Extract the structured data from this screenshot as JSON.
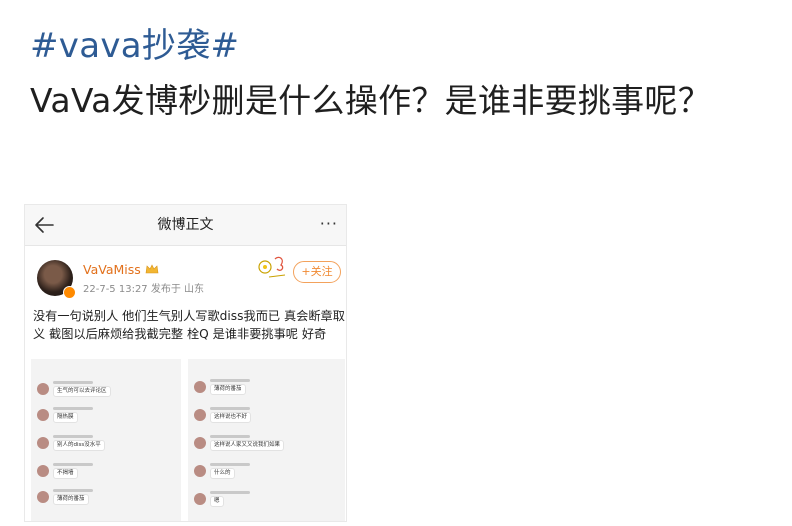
{
  "post": {
    "hashtag": "#vava抄袭#",
    "text": "VaVa发博秒删是什么操作？是谁非要挑事呢？"
  },
  "screenshot": {
    "page_title": "微博正文",
    "more_label": "···",
    "user_name": "VaVaMiss",
    "meta": "22-7-5 13:27  发布于 山东",
    "follow_label": "+关注",
    "body": "没有一句说别人 他们生气别人写歌diss我而已 真会断章取义 截图以后麻烦给我截完整 栓Q 是谁非要挑事呢 好奇",
    "chat_left": [
      "生气的可以去评论区",
      "隔热膜",
      "别人的diss没水平",
      "不揭墙",
      "薄荷的番茄"
    ],
    "chat_right": [
      "薄荷的番茄",
      "这样说也不好",
      "这样说人家又又说我们如果",
      "什么的",
      "嗯"
    ]
  },
  "colors": {
    "hashtag": "#2e5b94",
    "user_name": "#e2701b",
    "follow": "#f08a33"
  }
}
